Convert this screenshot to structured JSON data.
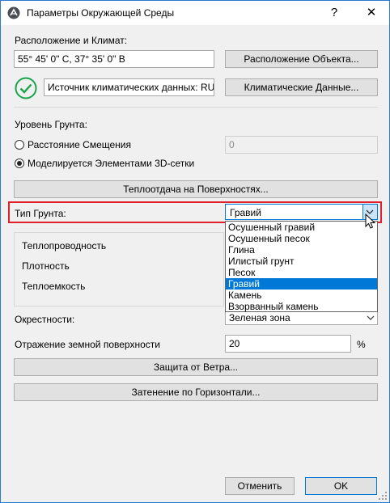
{
  "window": {
    "title": "Параметры Окружающей Среды",
    "help": "?",
    "close": "✕"
  },
  "location": {
    "section_label": "Расположение и Климат:",
    "coordinates": "55° 45' 0\" С, 37° 35' 0\" В",
    "location_button": "Расположение Объекта...",
    "climate_source": "Источник климатических данных: RUS",
    "climate_button": "Климатические Данные..."
  },
  "ground": {
    "section_label": "Уровень Грунта:",
    "offset_option": "Расстояние Смещения",
    "offset_value": "0",
    "mesh_option": "Моделируется Элементами 3D-сетки",
    "selected_option": "mesh",
    "heat_transfer_button": "Теплоотдача на Поверхностях..."
  },
  "soil": {
    "label": "Тип Грунта:",
    "value": "Гравий",
    "options": [
      "Осушенный гравий",
      "Осушенный песок",
      "Глина",
      "Илистый грунт",
      "Песок",
      "Гравий",
      "Камень",
      "Взорванный камень"
    ],
    "highlighted_index": 5,
    "properties": {
      "conductivity_label": "Теплопроводность",
      "density_label": "Плотность",
      "heat_capacity_label": "Теплоемкость"
    }
  },
  "surroundings": {
    "label": "Окрестности:",
    "value": "Зеленая зона"
  },
  "reflectance": {
    "label": "Отражение земной поверхности",
    "value": "20",
    "unit": "%"
  },
  "buttons": {
    "wind_protection": "Защита от Ветра...",
    "horizon_shading": "Затенение по Горизонтали...",
    "cancel": "Отменить",
    "ok": "OK"
  },
  "colors": {
    "accent": "#0078d7",
    "highlight": "#e0202a",
    "check_green": "#1aa34a"
  }
}
